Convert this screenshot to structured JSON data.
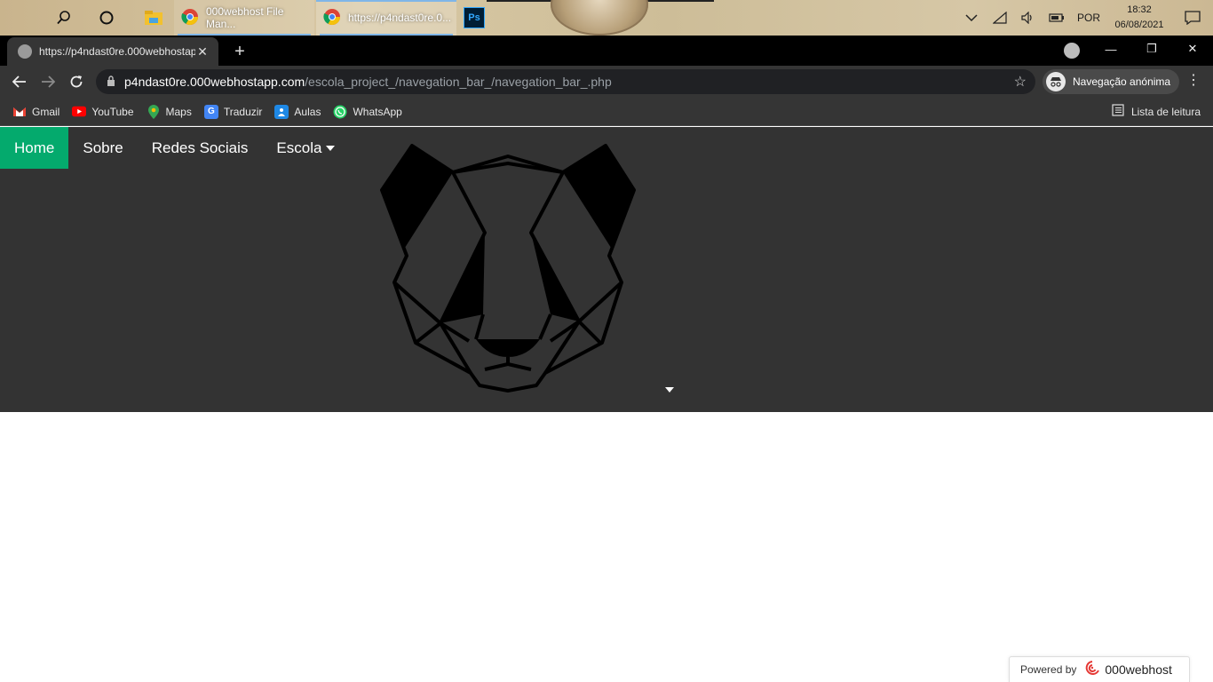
{
  "taskbar": {
    "apps": [
      {
        "label": "000webhost File Man...",
        "icon": "chrome-icon"
      },
      {
        "label": "https://p4ndast0re.0...",
        "icon": "chrome-icon"
      }
    ],
    "photoshop_label": "Ps",
    "tray": {
      "language": "POR",
      "time": "18:32",
      "date": "06/08/2021"
    }
  },
  "browser": {
    "tab_title": "https://p4ndast0re.000webhostapp.com",
    "url_host": "p4ndast0re.000webhostapp.com",
    "url_path": "/escola_project_/navegation_bar_/navegation_bar_.php",
    "incognito_label": "Navegação anónima",
    "bookmarks": [
      {
        "label": "Gmail",
        "icon": "gmail-icon"
      },
      {
        "label": "YouTube",
        "icon": "youtube-icon"
      },
      {
        "label": "Maps",
        "icon": "maps-icon"
      },
      {
        "label": "Traduzir",
        "icon": "translate-icon"
      },
      {
        "label": "Aulas",
        "icon": "classroom-icon"
      },
      {
        "label": "WhatsApp",
        "icon": "whatsapp-icon"
      }
    ],
    "reading_list_label": "Lista de leitura"
  },
  "page": {
    "nav": [
      {
        "label": "Home",
        "active": true
      },
      {
        "label": "Sobre",
        "active": false
      },
      {
        "label": "Redes Sociais",
        "active": false
      },
      {
        "label": "Escola",
        "active": false,
        "dropdown": true
      }
    ],
    "active_color": "#04aa6d",
    "navbar_color": "#333333"
  },
  "footer": {
    "powered_label": "Powered by",
    "brand_label": "000webhost"
  }
}
